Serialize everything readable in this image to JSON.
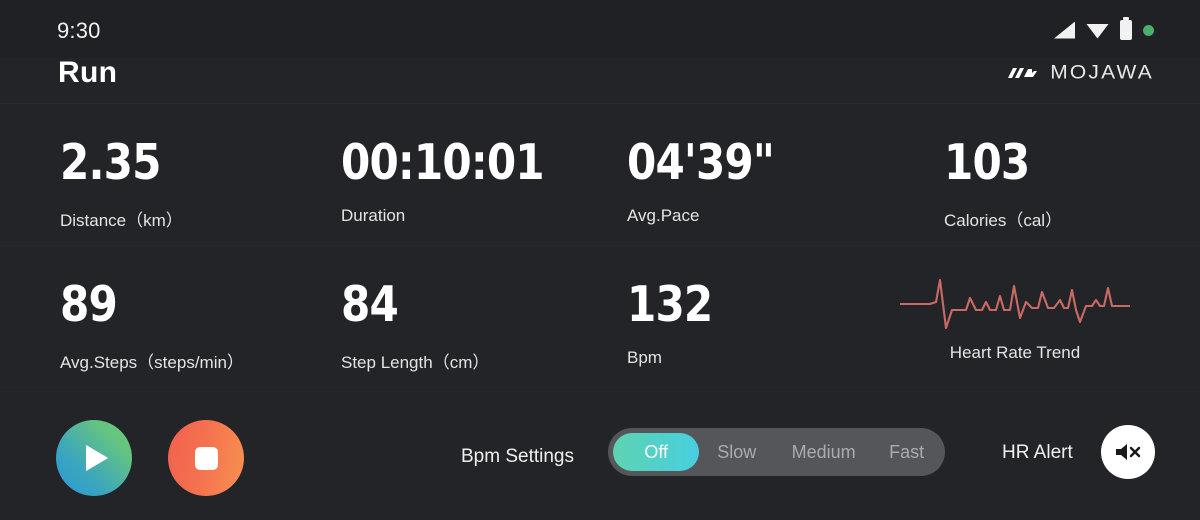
{
  "statusbar": {
    "time": "9:30",
    "icons": {
      "signal": "signal-bars-icon",
      "wifi": "wifi-icon",
      "battery": "battery-icon",
      "recording_dot": "green-status-dot-icon"
    }
  },
  "header": {
    "title": "Run",
    "brand": "MOJAWA",
    "brand_mark": "mojawa-logo-mark"
  },
  "metrics": [
    {
      "value": "2.35",
      "label": "Distance（km）"
    },
    {
      "value": "00:10:01",
      "label": "Duration"
    },
    {
      "value": "04'39\"",
      "label": "Avg.Pace"
    },
    {
      "value": "103",
      "label": "Calories（cal）"
    },
    {
      "value": "89",
      "label": "Avg.Steps（steps/min）"
    },
    {
      "value": "84",
      "label": "Step Length（cm）"
    },
    {
      "value": "132",
      "label": "Bpm"
    }
  ],
  "heart_rate_trend": {
    "label": "Heart Rate Trend",
    "icon": "ecg-waveform-icon",
    "color": "#c96a65"
  },
  "controls": {
    "play_button": {
      "icon": "play-icon",
      "gradient_from": "#2a9ad6",
      "gradient_to": "#71cb74"
    },
    "stop_button": {
      "icon": "stop-icon",
      "gradient_from": "#f2604f",
      "gradient_to": "#f89150"
    },
    "bpm_settings_label": "Bpm Settings",
    "bpm_options": [
      "Off",
      "Slow",
      "Medium",
      "Fast"
    ],
    "bpm_selected": "Off",
    "bpm_active_color": "#4fd0d8",
    "hr_alert_label": "HR Alert",
    "hr_alert_icon": "speaker-mute-icon"
  }
}
